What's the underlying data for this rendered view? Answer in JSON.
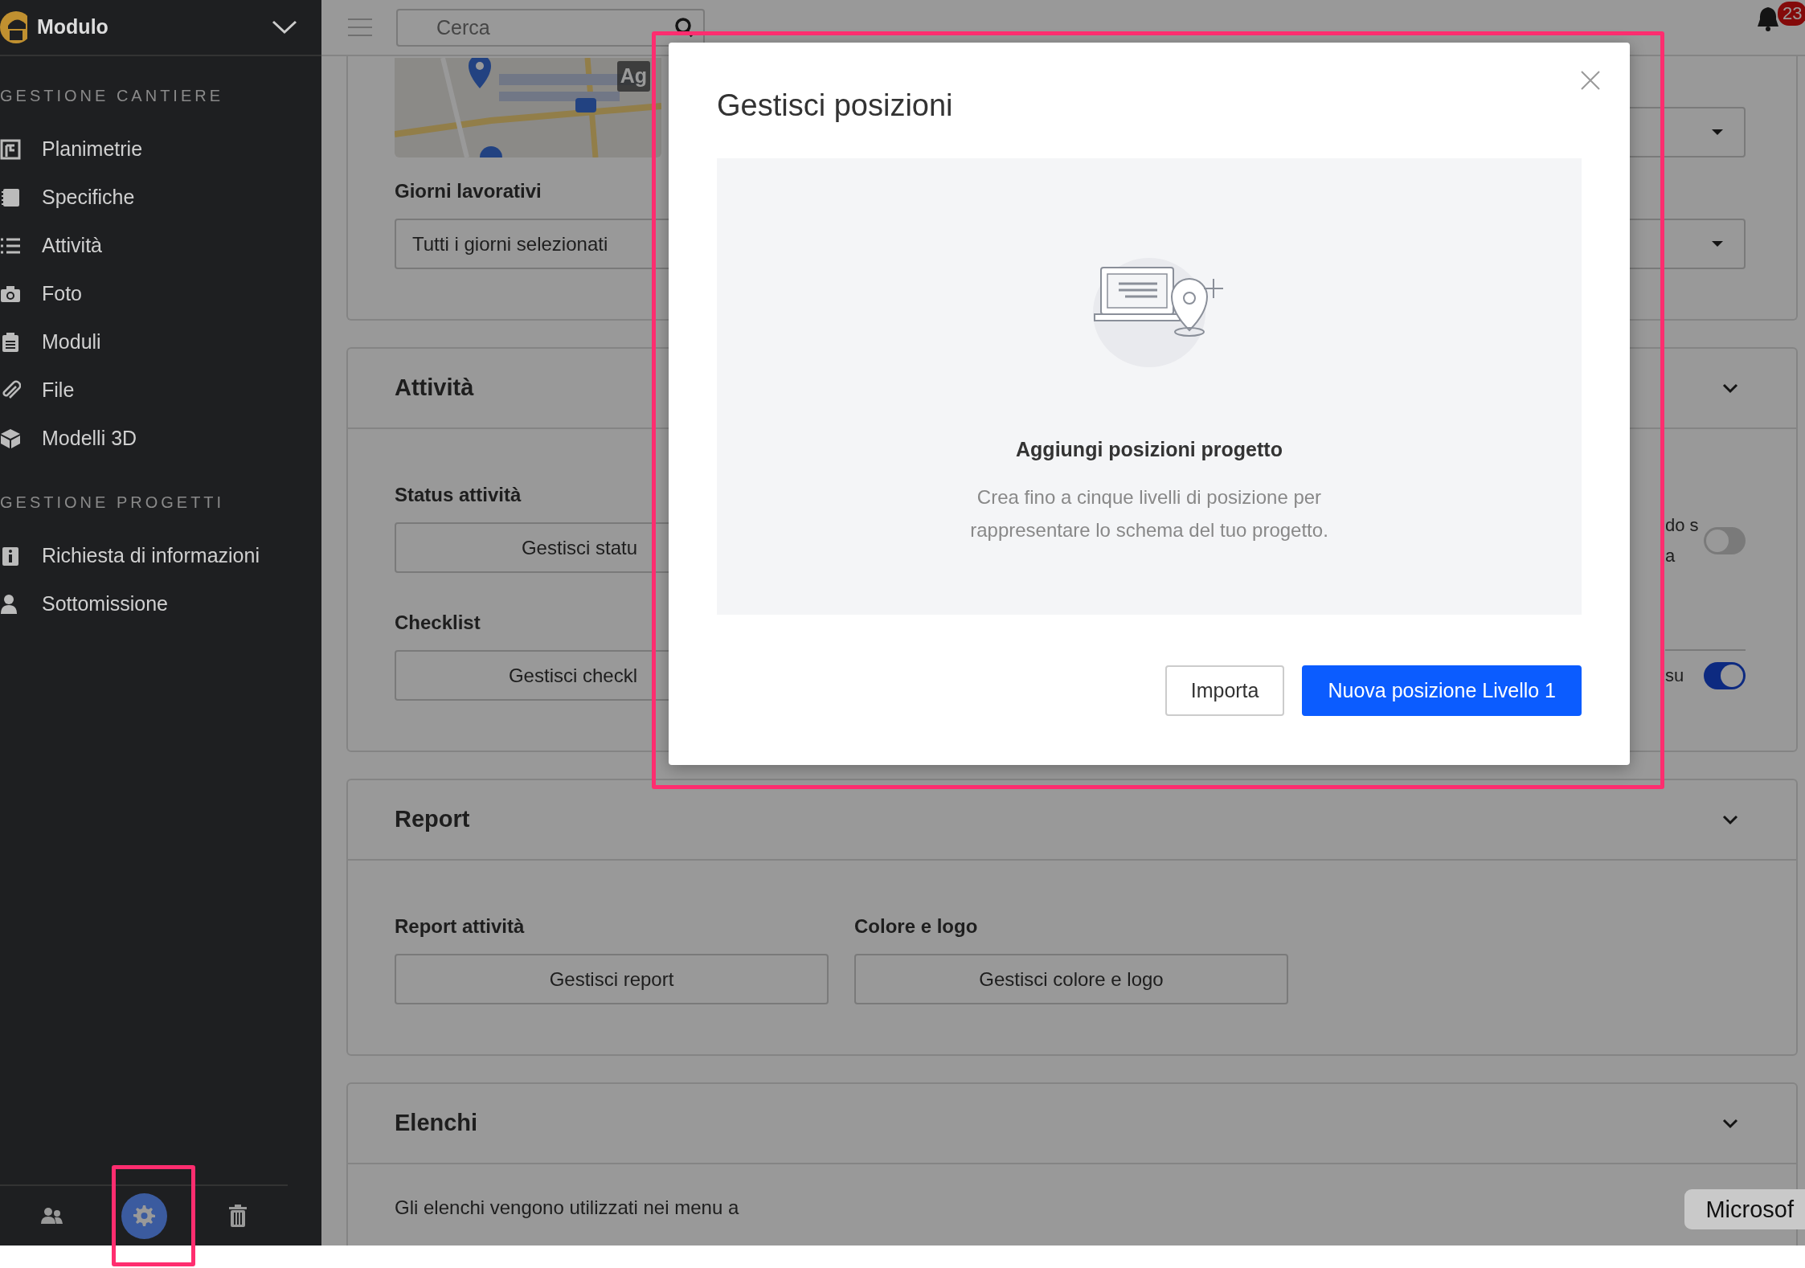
{
  "sidebar": {
    "title": "Modulo",
    "sections": [
      {
        "heading": "GESTIONE CANTIERE",
        "items": [
          {
            "label": "Planimetrie"
          },
          {
            "label": "Specifiche"
          },
          {
            "label": "Attività"
          },
          {
            "label": "Foto"
          },
          {
            "label": "Moduli"
          },
          {
            "label": "File"
          },
          {
            "label": "Modelli 3D"
          }
        ]
      },
      {
        "heading": "GESTIONE PROGETTI",
        "items": [
          {
            "label": "Richiesta di informazioni"
          },
          {
            "label": "Sottomissione"
          }
        ]
      }
    ],
    "footer_buttons": [
      {
        "selected": false
      },
      {
        "selected": true,
        "highlighted": true
      },
      {
        "selected": false
      }
    ]
  },
  "topbar": {
    "search": {
      "placeholder": "Cerca"
    },
    "notifications_badge": "23"
  },
  "cards": [
    {
      "kind": "general",
      "map_label": "Ag",
      "field_label": "Giorni lavorativi",
      "field_value": "Tutti i giorni selezionati"
    },
    {
      "kind": "settings",
      "title": "Attività",
      "rows": [
        {
          "label": "Status attività",
          "button": "Gestisci statu",
          "side_text": [
            "do s",
            "a"
          ],
          "toggle_on": false
        },
        {
          "label": "Checklist",
          "button": "Gestisci checkl",
          "side_text": [
            "su"
          ],
          "toggle_on": true
        }
      ]
    },
    {
      "kind": "columns",
      "title": "Report",
      "columns": [
        {
          "label": "Report attività",
          "button": "Gestisci report"
        },
        {
          "label": "Colore e logo",
          "button": "Gestisci colore e logo"
        }
      ]
    },
    {
      "kind": "text",
      "title": "Elenchi",
      "text": "Gli elenchi vengono utilizzati nei menu a"
    }
  ],
  "modal": {
    "highlighted": true,
    "title": "Gestisci posizioni",
    "empty_title": "Aggiungi posizioni progetto",
    "empty_text": [
      "Crea fino a cinque livelli di posizione per",
      "rappresentare lo schema del tuo progetto."
    ],
    "buttons": [
      {
        "label": "Importa",
        "kind": "secondary"
      },
      {
        "label": "Nuova posizione Livello 1",
        "kind": "primary"
      }
    ]
  },
  "tooltip": "Microsof"
}
